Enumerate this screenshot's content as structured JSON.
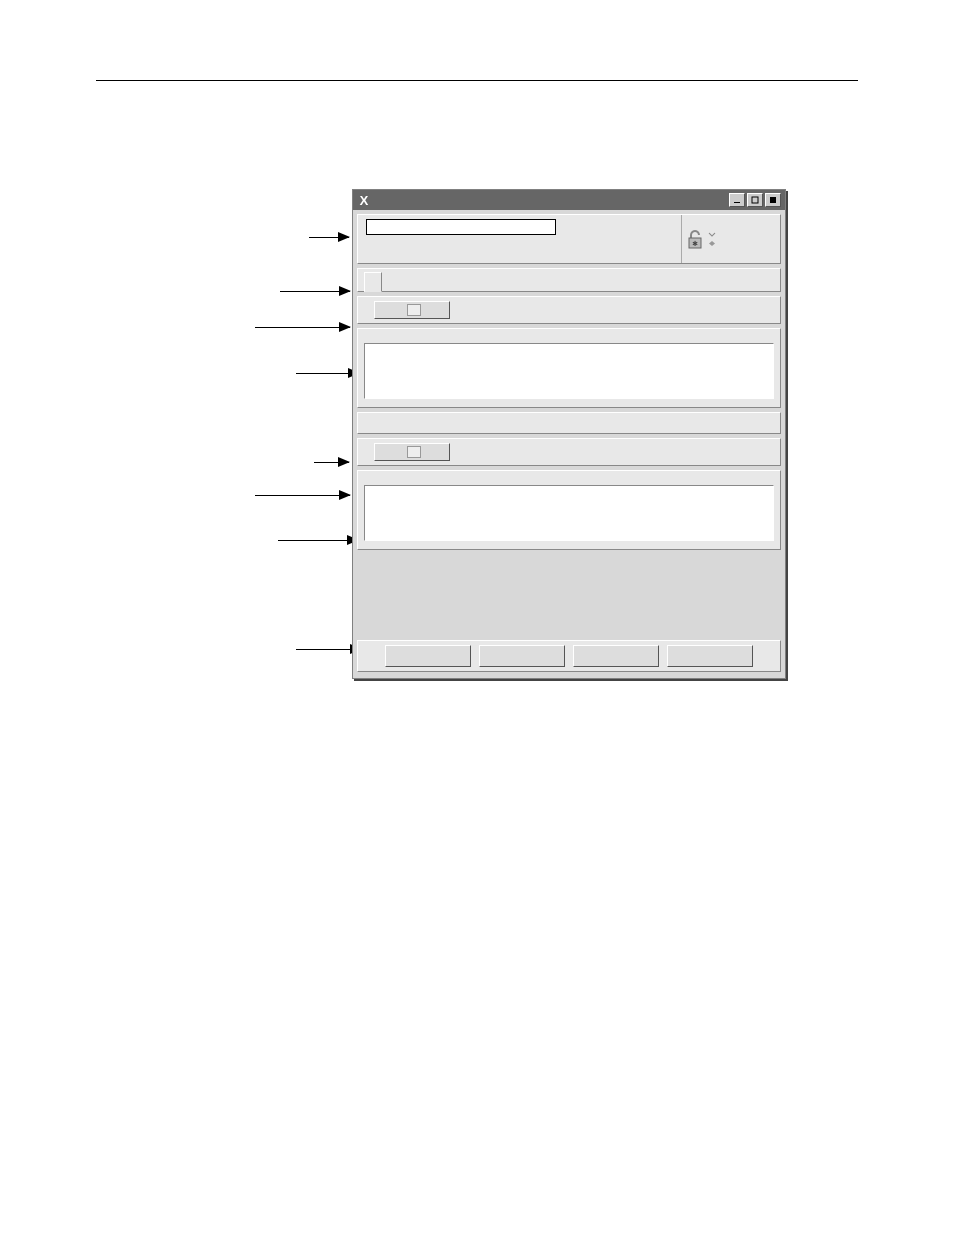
{
  "titlebar": {
    "icon": "X",
    "title": "",
    "minimize": "min",
    "maximize": "max",
    "close": "close"
  },
  "top_row": {
    "label": "",
    "input_value": "",
    "lock_icon": "lock-open"
  },
  "tabs": {
    "tab1": ""
  },
  "section1": {
    "label": "",
    "button": "",
    "listbox_label": ""
  },
  "section2": {
    "label": "",
    "button": "",
    "listbox_label": ""
  },
  "actions": {
    "btn1": "",
    "btn2": "",
    "btn3": "",
    "btn4": ""
  }
}
